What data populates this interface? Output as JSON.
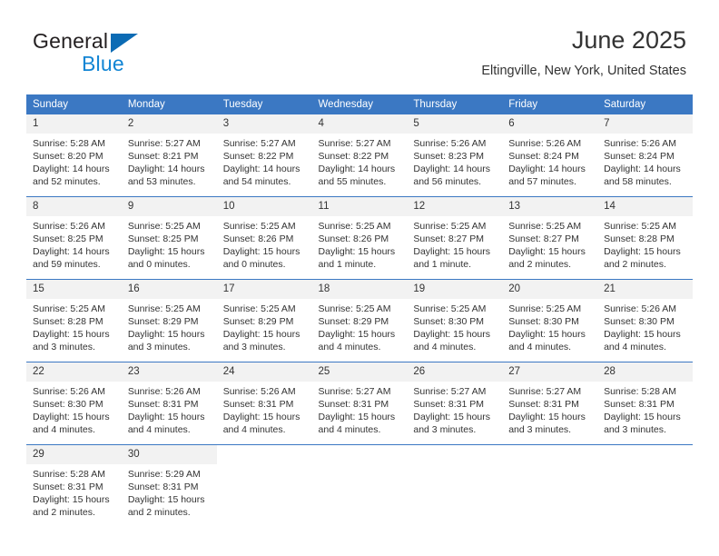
{
  "logo": {
    "word_top": "General",
    "word_bottom": "Blue",
    "triangle_color": "#0c6bb4",
    "blue_color": "#1285d4"
  },
  "header": {
    "title": "June 2025",
    "location": "Eltingville, New York, United States"
  },
  "theme": {
    "header_blue": "#3b78c3",
    "daynum_gray": "#f2f2f2",
    "text": "#333333"
  },
  "weekday_headers": [
    "Sunday",
    "Monday",
    "Tuesday",
    "Wednesday",
    "Thursday",
    "Friday",
    "Saturday"
  ],
  "weeks": [
    [
      {
        "day": "1",
        "sunrise": "Sunrise: 5:28 AM",
        "sunset": "Sunset: 8:20 PM",
        "daylight1": "Daylight: 14 hours",
        "daylight2": "and 52 minutes."
      },
      {
        "day": "2",
        "sunrise": "Sunrise: 5:27 AM",
        "sunset": "Sunset: 8:21 PM",
        "daylight1": "Daylight: 14 hours",
        "daylight2": "and 53 minutes."
      },
      {
        "day": "3",
        "sunrise": "Sunrise: 5:27 AM",
        "sunset": "Sunset: 8:22 PM",
        "daylight1": "Daylight: 14 hours",
        "daylight2": "and 54 minutes."
      },
      {
        "day": "4",
        "sunrise": "Sunrise: 5:27 AM",
        "sunset": "Sunset: 8:22 PM",
        "daylight1": "Daylight: 14 hours",
        "daylight2": "and 55 minutes."
      },
      {
        "day": "5",
        "sunrise": "Sunrise: 5:26 AM",
        "sunset": "Sunset: 8:23 PM",
        "daylight1": "Daylight: 14 hours",
        "daylight2": "and 56 minutes."
      },
      {
        "day": "6",
        "sunrise": "Sunrise: 5:26 AM",
        "sunset": "Sunset: 8:24 PM",
        "daylight1": "Daylight: 14 hours",
        "daylight2": "and 57 minutes."
      },
      {
        "day": "7",
        "sunrise": "Sunrise: 5:26 AM",
        "sunset": "Sunset: 8:24 PM",
        "daylight1": "Daylight: 14 hours",
        "daylight2": "and 58 minutes."
      }
    ],
    [
      {
        "day": "8",
        "sunrise": "Sunrise: 5:26 AM",
        "sunset": "Sunset: 8:25 PM",
        "daylight1": "Daylight: 14 hours",
        "daylight2": "and 59 minutes."
      },
      {
        "day": "9",
        "sunrise": "Sunrise: 5:25 AM",
        "sunset": "Sunset: 8:25 PM",
        "daylight1": "Daylight: 15 hours",
        "daylight2": "and 0 minutes."
      },
      {
        "day": "10",
        "sunrise": "Sunrise: 5:25 AM",
        "sunset": "Sunset: 8:26 PM",
        "daylight1": "Daylight: 15 hours",
        "daylight2": "and 0 minutes."
      },
      {
        "day": "11",
        "sunrise": "Sunrise: 5:25 AM",
        "sunset": "Sunset: 8:26 PM",
        "daylight1": "Daylight: 15 hours",
        "daylight2": "and 1 minute."
      },
      {
        "day": "12",
        "sunrise": "Sunrise: 5:25 AM",
        "sunset": "Sunset: 8:27 PM",
        "daylight1": "Daylight: 15 hours",
        "daylight2": "and 1 minute."
      },
      {
        "day": "13",
        "sunrise": "Sunrise: 5:25 AM",
        "sunset": "Sunset: 8:27 PM",
        "daylight1": "Daylight: 15 hours",
        "daylight2": "and 2 minutes."
      },
      {
        "day": "14",
        "sunrise": "Sunrise: 5:25 AM",
        "sunset": "Sunset: 8:28 PM",
        "daylight1": "Daylight: 15 hours",
        "daylight2": "and 2 minutes."
      }
    ],
    [
      {
        "day": "15",
        "sunrise": "Sunrise: 5:25 AM",
        "sunset": "Sunset: 8:28 PM",
        "daylight1": "Daylight: 15 hours",
        "daylight2": "and 3 minutes."
      },
      {
        "day": "16",
        "sunrise": "Sunrise: 5:25 AM",
        "sunset": "Sunset: 8:29 PM",
        "daylight1": "Daylight: 15 hours",
        "daylight2": "and 3 minutes."
      },
      {
        "day": "17",
        "sunrise": "Sunrise: 5:25 AM",
        "sunset": "Sunset: 8:29 PM",
        "daylight1": "Daylight: 15 hours",
        "daylight2": "and 3 minutes."
      },
      {
        "day": "18",
        "sunrise": "Sunrise: 5:25 AM",
        "sunset": "Sunset: 8:29 PM",
        "daylight1": "Daylight: 15 hours",
        "daylight2": "and 4 minutes."
      },
      {
        "day": "19",
        "sunrise": "Sunrise: 5:25 AM",
        "sunset": "Sunset: 8:30 PM",
        "daylight1": "Daylight: 15 hours",
        "daylight2": "and 4 minutes."
      },
      {
        "day": "20",
        "sunrise": "Sunrise: 5:25 AM",
        "sunset": "Sunset: 8:30 PM",
        "daylight1": "Daylight: 15 hours",
        "daylight2": "and 4 minutes."
      },
      {
        "day": "21",
        "sunrise": "Sunrise: 5:26 AM",
        "sunset": "Sunset: 8:30 PM",
        "daylight1": "Daylight: 15 hours",
        "daylight2": "and 4 minutes."
      }
    ],
    [
      {
        "day": "22",
        "sunrise": "Sunrise: 5:26 AM",
        "sunset": "Sunset: 8:30 PM",
        "daylight1": "Daylight: 15 hours",
        "daylight2": "and 4 minutes."
      },
      {
        "day": "23",
        "sunrise": "Sunrise: 5:26 AM",
        "sunset": "Sunset: 8:31 PM",
        "daylight1": "Daylight: 15 hours",
        "daylight2": "and 4 minutes."
      },
      {
        "day": "24",
        "sunrise": "Sunrise: 5:26 AM",
        "sunset": "Sunset: 8:31 PM",
        "daylight1": "Daylight: 15 hours",
        "daylight2": "and 4 minutes."
      },
      {
        "day": "25",
        "sunrise": "Sunrise: 5:27 AM",
        "sunset": "Sunset: 8:31 PM",
        "daylight1": "Daylight: 15 hours",
        "daylight2": "and 4 minutes."
      },
      {
        "day": "26",
        "sunrise": "Sunrise: 5:27 AM",
        "sunset": "Sunset: 8:31 PM",
        "daylight1": "Daylight: 15 hours",
        "daylight2": "and 3 minutes."
      },
      {
        "day": "27",
        "sunrise": "Sunrise: 5:27 AM",
        "sunset": "Sunset: 8:31 PM",
        "daylight1": "Daylight: 15 hours",
        "daylight2": "and 3 minutes."
      },
      {
        "day": "28",
        "sunrise": "Sunrise: 5:28 AM",
        "sunset": "Sunset: 8:31 PM",
        "daylight1": "Daylight: 15 hours",
        "daylight2": "and 3 minutes."
      }
    ],
    [
      {
        "day": "29",
        "sunrise": "Sunrise: 5:28 AM",
        "sunset": "Sunset: 8:31 PM",
        "daylight1": "Daylight: 15 hours",
        "daylight2": "and 2 minutes."
      },
      {
        "day": "30",
        "sunrise": "Sunrise: 5:29 AM",
        "sunset": "Sunset: 8:31 PM",
        "daylight1": "Daylight: 15 hours",
        "daylight2": "and 2 minutes."
      },
      {
        "day": "",
        "sunrise": "",
        "sunset": "",
        "daylight1": "",
        "daylight2": ""
      },
      {
        "day": "",
        "sunrise": "",
        "sunset": "",
        "daylight1": "",
        "daylight2": ""
      },
      {
        "day": "",
        "sunrise": "",
        "sunset": "",
        "daylight1": "",
        "daylight2": ""
      },
      {
        "day": "",
        "sunrise": "",
        "sunset": "",
        "daylight1": "",
        "daylight2": ""
      },
      {
        "day": "",
        "sunrise": "",
        "sunset": "",
        "daylight1": "",
        "daylight2": ""
      }
    ]
  ]
}
